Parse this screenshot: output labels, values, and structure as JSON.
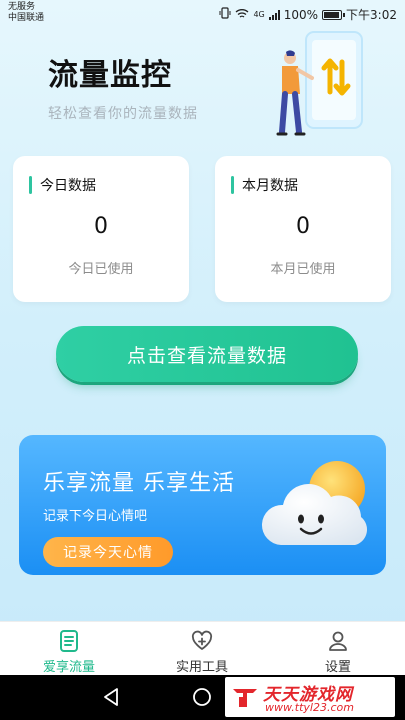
{
  "status_bar": {
    "carrier_line1": "无服务",
    "carrier_line2": "中国联通",
    "network": "4G",
    "battery": "100%",
    "time": "下午3:02"
  },
  "header": {
    "title": "流量监控",
    "subtitle": "轻松查看你的流量数据"
  },
  "cards": [
    {
      "title": "今日数据",
      "value": "0",
      "caption": "今日已使用"
    },
    {
      "title": "本月数据",
      "value": "0",
      "caption": "本月已使用"
    }
  ],
  "main_button": {
    "label": "点击查看流量数据"
  },
  "banner": {
    "title": "乐享流量 乐享生活",
    "subtitle": "记录下今日心情吧",
    "button": "记录今天心情"
  },
  "bottom_nav": {
    "items": [
      {
        "label": "爱享流量",
        "icon": "document-icon",
        "active": true
      },
      {
        "label": "实用工具",
        "icon": "heart-plus-icon",
        "active": false
      },
      {
        "label": "设置",
        "icon": "user-icon",
        "active": false
      }
    ]
  },
  "watermark": {
    "title": "天天游戏网",
    "url": "www.ttyl23.com"
  },
  "colors": {
    "accent_green": "#20c291",
    "banner_blue": "#1b8ff4",
    "button_orange": "#ff9a2a",
    "watermark_red": "#e3262c"
  }
}
